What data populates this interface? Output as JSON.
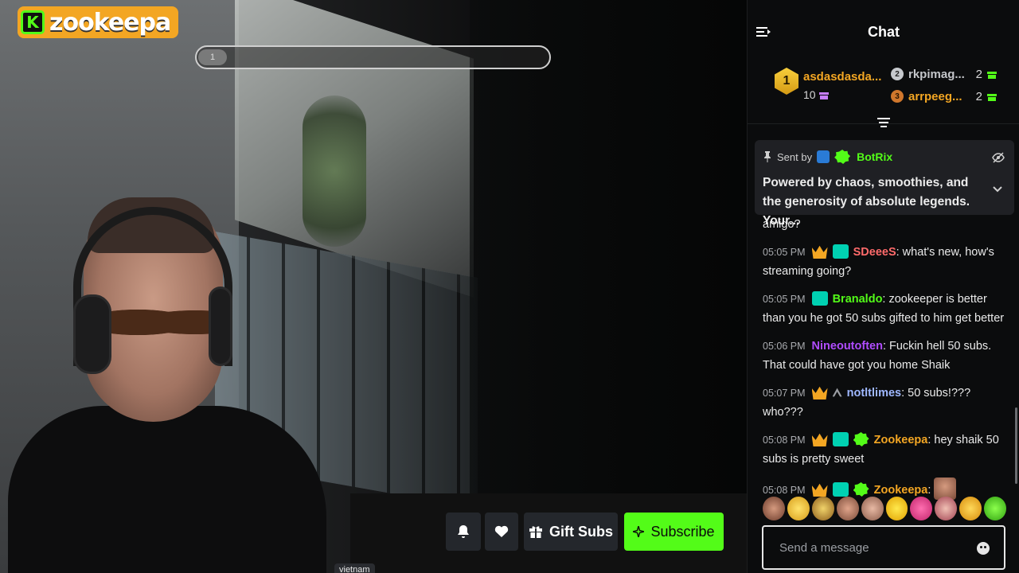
{
  "overlay": {
    "brand_logo_letter": "K",
    "brand_name": "zookeepa",
    "progress_label": "1",
    "location_tag": "vietnam"
  },
  "player_controls": {
    "notify_icon": "bell-icon",
    "follow_icon": "heart-icon",
    "gift_label": "Gift Subs",
    "subscribe_label": "Subscribe",
    "accent_color": "#53fc18"
  },
  "chat": {
    "title": "Chat",
    "leaderboard": [
      {
        "rank": "1",
        "name": "asdasdasda...",
        "count": "10"
      },
      {
        "rank": "2",
        "name": "rkpimag...",
        "count": "2"
      },
      {
        "rank": "3",
        "name": "arrpeeg...",
        "count": "2"
      }
    ],
    "pinned": {
      "sent_by_label": "Sent by",
      "author": "BotRix",
      "text": "Powered by chaos, smoothies, and the generosity of absolute legends. Your..."
    },
    "partial_message": "amigo?",
    "messages": [
      {
        "time": "05:05 PM",
        "user": "SDeeeS",
        "text": ": what's new, how's streaming going?"
      },
      {
        "time": "05:05 PM",
        "user": "Branaldo",
        "text": ": zookeeper is better than you he got 50 subs gifted to him get better"
      },
      {
        "time": "05:06 PM",
        "user": "Nineoutoften",
        "text": ": Fuckin hell 50 subs. That could have got you home Shaik"
      },
      {
        "time": "05:07 PM",
        "user": "notltlimes",
        "text": ": 50 subs!??? who???"
      },
      {
        "time": "05:08 PM",
        "user": "Zookeepa",
        "text": ": hey shaik 50 subs is pretty sweet"
      },
      {
        "time": "05:08 PM",
        "user": "Zookeepa",
        "text": ":"
      }
    ],
    "input_placeholder": "Send a message",
    "colors": {
      "SDeeeS": "#ff6b6b",
      "Branaldo": "#53fc18",
      "Nineoutoften": "#b04cff",
      "notltlimes": "#9fb8ff",
      "Zookeepa": "#f3a623"
    }
  }
}
